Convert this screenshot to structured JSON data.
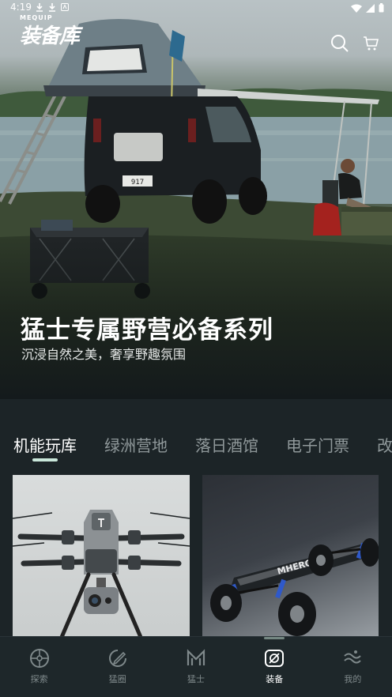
{
  "status_bar": {
    "time": "4:19",
    "notification_icons": [
      "download-icon",
      "download-icon",
      "app-notification-icon"
    ],
    "system_icons": [
      "wifi-icon",
      "signal-icon",
      "battery-icon"
    ]
  },
  "header": {
    "logo_sub": "MEQUIP",
    "logo_main": "装备库",
    "search_icon": "search-icon",
    "cart_icon": "cart-icon"
  },
  "hero": {
    "title": "猛士专属野营必备系列",
    "subtitle": "沉浸自然之美，奢享野趣氛围",
    "plate": "917"
  },
  "tabs": [
    {
      "label": "机能玩库",
      "active": true
    },
    {
      "label": "绿洲营地",
      "active": false
    },
    {
      "label": "落日酒馆",
      "active": false
    },
    {
      "label": "电子门票",
      "active": false
    },
    {
      "label": "改",
      "active": false
    }
  ],
  "cards": [
    {
      "image": "drone-product-image"
    },
    {
      "image": "electric-skateboard-product-image",
      "brand_text": "MHERO"
    }
  ],
  "bottom_nav": [
    {
      "label": "探索",
      "icon": "explore-icon",
      "active": false
    },
    {
      "label": "猛圈",
      "icon": "community-icon",
      "active": false
    },
    {
      "label": "猛士",
      "icon": "mhero-logo-icon",
      "active": false
    },
    {
      "label": "装备",
      "icon": "equipment-icon",
      "active": true
    },
    {
      "label": "我的",
      "icon": "profile-icon",
      "active": false
    }
  ],
  "colors": {
    "accent": "#c9e7da",
    "background": "#1c2427",
    "nav_background": "#1e272a",
    "inactive_text": "#8f989a"
  }
}
